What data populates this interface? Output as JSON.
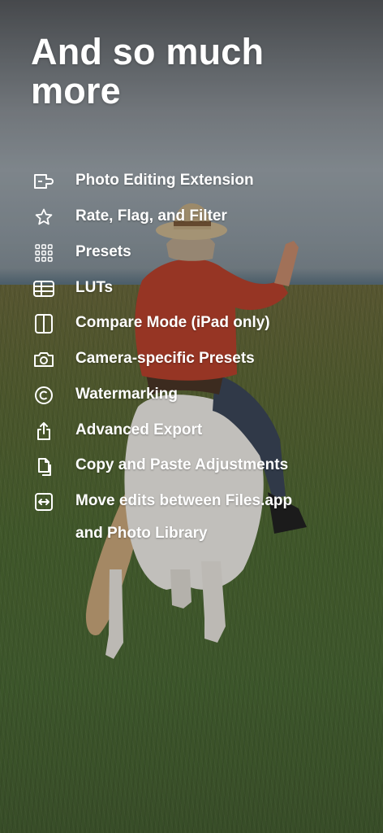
{
  "title": "And so much more",
  "features": [
    {
      "icon": "extension-icon",
      "label": "Photo Editing Extension"
    },
    {
      "icon": "star-icon",
      "label": "Rate, Flag, and Filter"
    },
    {
      "icon": "grid-dots-icon",
      "label": "Presets"
    },
    {
      "icon": "table-icon",
      "label": "LUTs"
    },
    {
      "icon": "split-view-icon",
      "label": "Compare Mode (iPad only)"
    },
    {
      "icon": "camera-icon",
      "label": "Camera-specific Presets"
    },
    {
      "icon": "copyright-icon",
      "label": "Watermarking"
    },
    {
      "icon": "share-icon",
      "label": "Advanced Export"
    },
    {
      "icon": "copy-paste-icon",
      "label": "Copy and Paste Adjustments"
    },
    {
      "icon": "move-files-icon",
      "label": "Move edits between Files.app",
      "label_line2": "and Photo Library"
    }
  ]
}
